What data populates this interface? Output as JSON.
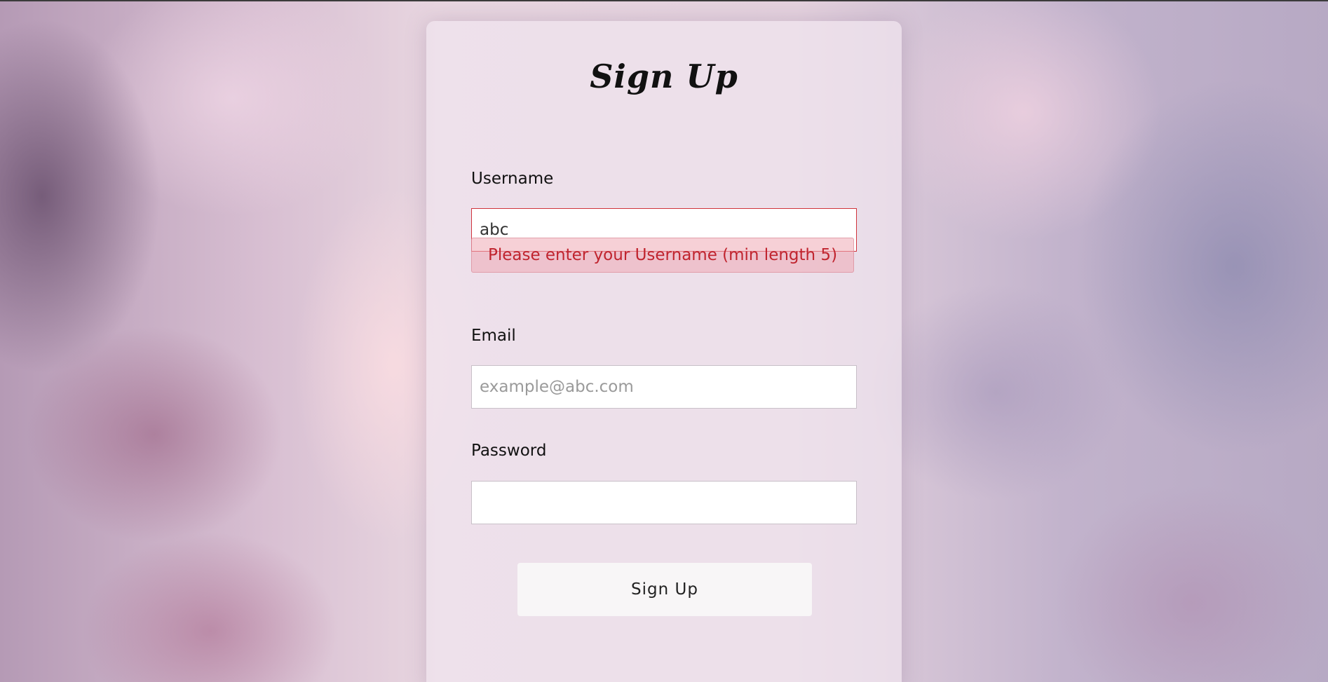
{
  "form": {
    "title": "Sign Up",
    "username": {
      "label": "Username",
      "value": "abc",
      "error": "Please enter your Username (min length 5)"
    },
    "email": {
      "label": "Email",
      "placeholder": "example@abc.com",
      "value": ""
    },
    "password": {
      "label": "Password",
      "value": ""
    },
    "submit_label": "Sign Up"
  },
  "colors": {
    "error": "#c0242e",
    "error_border": "#d0343c",
    "button_bg": "#f8f6f7"
  }
}
